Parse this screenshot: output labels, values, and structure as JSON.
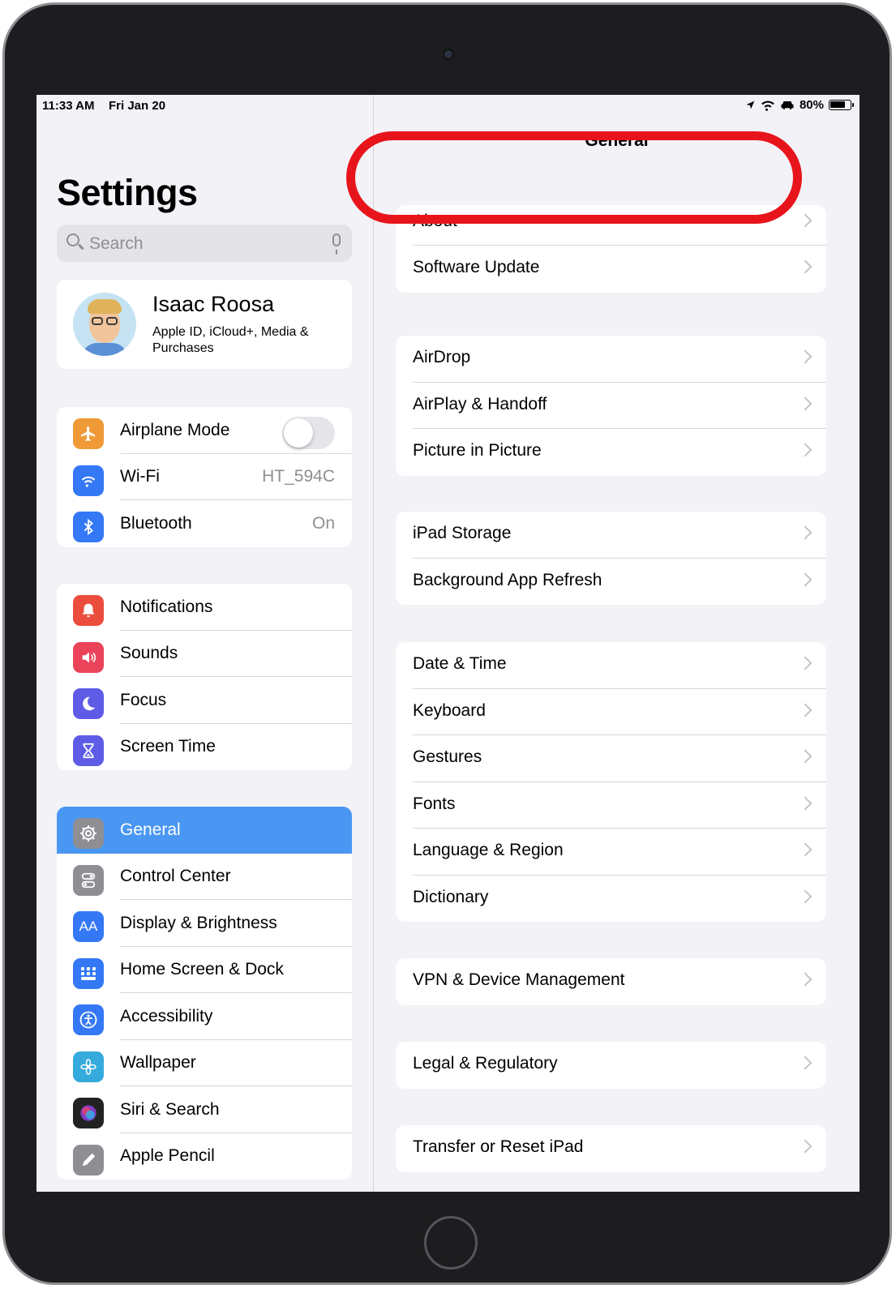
{
  "status_bar": {
    "time": "11:33 AM",
    "date": "Fri Jan 20",
    "battery": "80%",
    "battery_level": 0.8
  },
  "sidebar": {
    "title": "Settings",
    "search_placeholder": "Search",
    "profile": {
      "name": "Isaac Roosa",
      "subtitle": "Apple ID, iCloud+, Media & Purchases"
    },
    "group1": [
      {
        "label": "Airplane Mode",
        "icon": "airplane-icon",
        "color": "#f09a37",
        "toggle": false
      },
      {
        "label": "Wi-Fi",
        "icon": "wifi-icon",
        "color": "#3478f6",
        "value": "HT_594C"
      },
      {
        "label": "Bluetooth",
        "icon": "bluetooth-icon",
        "color": "#3478f6",
        "value": "On"
      }
    ],
    "group2": [
      {
        "label": "Notifications",
        "icon": "bell-icon",
        "color": "#eb4d3d"
      },
      {
        "label": "Sounds",
        "icon": "speaker-icon",
        "color": "#eb445a"
      },
      {
        "label": "Focus",
        "icon": "moon-icon",
        "color": "#5e5ce6"
      },
      {
        "label": "Screen Time",
        "icon": "hourglass-icon",
        "color": "#5e5ce6"
      }
    ],
    "group3": [
      {
        "label": "General",
        "icon": "gear-icon",
        "color": "#8e8e93",
        "selected": true
      },
      {
        "label": "Control Center",
        "icon": "toggles-icon",
        "color": "#8e8e93"
      },
      {
        "label": "Display & Brightness",
        "icon": "text-size-icon",
        "color": "#3478f6",
        "glyph": "AA"
      },
      {
        "label": "Home Screen & Dock",
        "icon": "app-grid-icon",
        "color": "#3478f6"
      },
      {
        "label": "Accessibility",
        "icon": "accessibility-icon",
        "color": "#3478f6"
      },
      {
        "label": "Wallpaper",
        "icon": "flower-icon",
        "color": "#35aadc"
      },
      {
        "label": "Siri & Search",
        "icon": "siri-icon",
        "color": "#222222"
      },
      {
        "label": "Apple Pencil",
        "icon": "pencil-icon",
        "color": "#8e8e93"
      }
    ]
  },
  "detail": {
    "title": "General",
    "groups": [
      [
        "About",
        "Software Update"
      ],
      [
        "AirDrop",
        "AirPlay & Handoff",
        "Picture in Picture"
      ],
      [
        "iPad Storage",
        "Background App Refresh"
      ],
      [
        "Date & Time",
        "Keyboard",
        "Gestures",
        "Fonts",
        "Language & Region",
        "Dictionary"
      ],
      [
        "VPN & Device Management"
      ],
      [
        "Legal & Regulatory"
      ],
      [
        "Transfer or Reset iPad"
      ]
    ],
    "highlight_color": "#e8141b"
  }
}
